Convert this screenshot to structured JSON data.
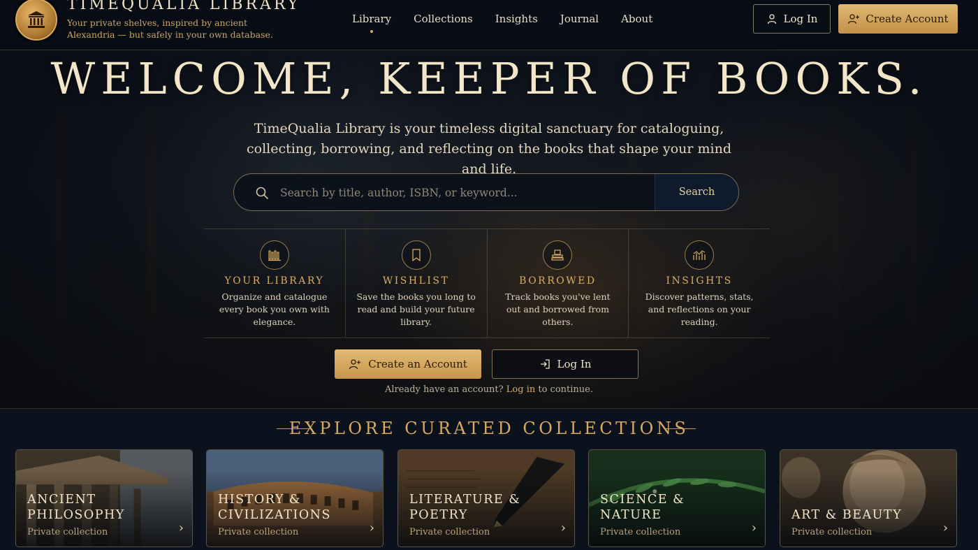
{
  "brand": {
    "name": "TIMEQUALIA LIBRARY",
    "tagline": "Your private shelves, inspired by ancient Alexandria — but safely in your own database.",
    "logo_icon": "temple-icon"
  },
  "nav": {
    "items": [
      {
        "label": "Library",
        "active": true
      },
      {
        "label": "Collections",
        "active": false
      },
      {
        "label": "Insights",
        "active": false
      },
      {
        "label": "Journal",
        "active": false
      },
      {
        "label": "About",
        "active": false
      }
    ],
    "login_label": "Log In",
    "create_account_label": "Create Account"
  },
  "hero": {
    "title": "WELCOME, KEEPER OF BOOKS.",
    "subtitle": "TimeQualia Library is your timeless digital sanctuary for cataloguing, collecting, borrowing, and reflecting on the books that shape your mind and life."
  },
  "search": {
    "placeholder": "Search by title, author, ISBN, or keyword...",
    "value": "",
    "button_label": "Search"
  },
  "features": [
    {
      "icon": "bookshelf-icon",
      "title": "YOUR LIBRARY",
      "desc": "Organize and catalogue every book you own with elegance."
    },
    {
      "icon": "bookmark-icon",
      "title": "WISHLIST",
      "desc": "Save the books you long to read and build your future library."
    },
    {
      "icon": "book-stack-icon",
      "title": "BORROWED",
      "desc": "Track books you've lent out and borrowed from others."
    },
    {
      "icon": "chart-icon",
      "title": "INSIGHTS",
      "desc": "Discover patterns, stats, and reflections on your reading."
    }
  ],
  "cta": {
    "create_label": "Create an Account",
    "login_label": "Log In",
    "already_prefix": "Already have an account?",
    "already_link": "Log in",
    "already_suffix": "to continue."
  },
  "collections": {
    "title": "EXPLORE CURATED COLLECTIONS",
    "cards": [
      {
        "title": "ANCIENT PHILOSOPHY",
        "sub": "Private collection"
      },
      {
        "title": "HISTORY & CIVILIZATIONS",
        "sub": "Private collection"
      },
      {
        "title": "LITERATURE & POETRY",
        "sub": "Private collection"
      },
      {
        "title": "SCIENCE & NATURE",
        "sub": "Private collection"
      },
      {
        "title": "ART & BEAUTY",
        "sub": "Private collection"
      }
    ]
  },
  "colors": {
    "accent_gold": "#d6aa60",
    "background_navy": "#0b111d",
    "text_cream": "#f3e6c8"
  }
}
